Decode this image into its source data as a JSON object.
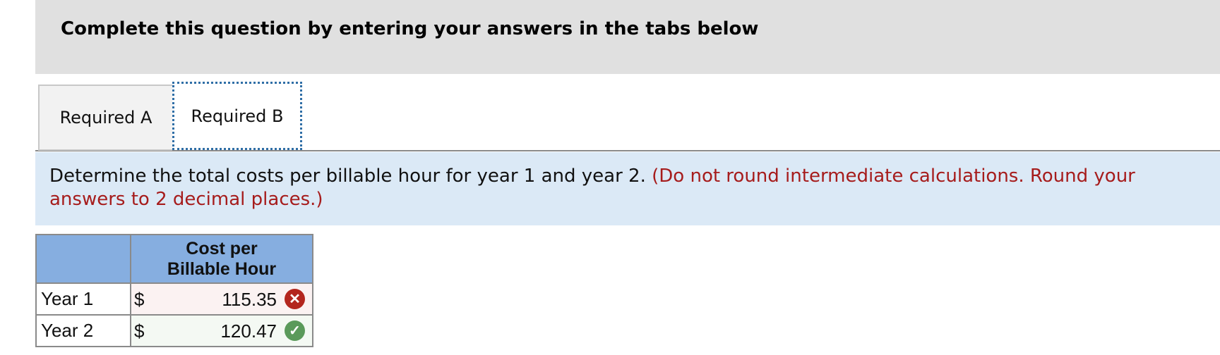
{
  "header": {
    "title": "Complete this question by entering your answers in the tabs below"
  },
  "tabs": [
    {
      "label": "Required A",
      "active": false
    },
    {
      "label": "Required B",
      "active": true
    }
  ],
  "instruction": {
    "text": "Determine the total costs per billable hour for year 1 and year 2.",
    "note": "(Do not round intermediate calculations. Round your answers to 2 decimal places.)"
  },
  "table": {
    "header": "Cost per Billable Hour",
    "rows": [
      {
        "label": "Year 1",
        "currency": "$",
        "value": "115.35",
        "status": "incorrect"
      },
      {
        "label": "Year 2",
        "currency": "$",
        "value": "120.47",
        "status": "correct"
      }
    ]
  },
  "colors": {
    "header_band": "#e0e0e0",
    "instruction_band": "#dbe9f6",
    "table_header": "#86aee0",
    "note_red": "#a61c1c",
    "incorrect": "#b3261e",
    "correct": "#5a9a5a"
  },
  "icons": {
    "incorrect": "x-circle-icon",
    "correct": "check-circle-icon"
  }
}
